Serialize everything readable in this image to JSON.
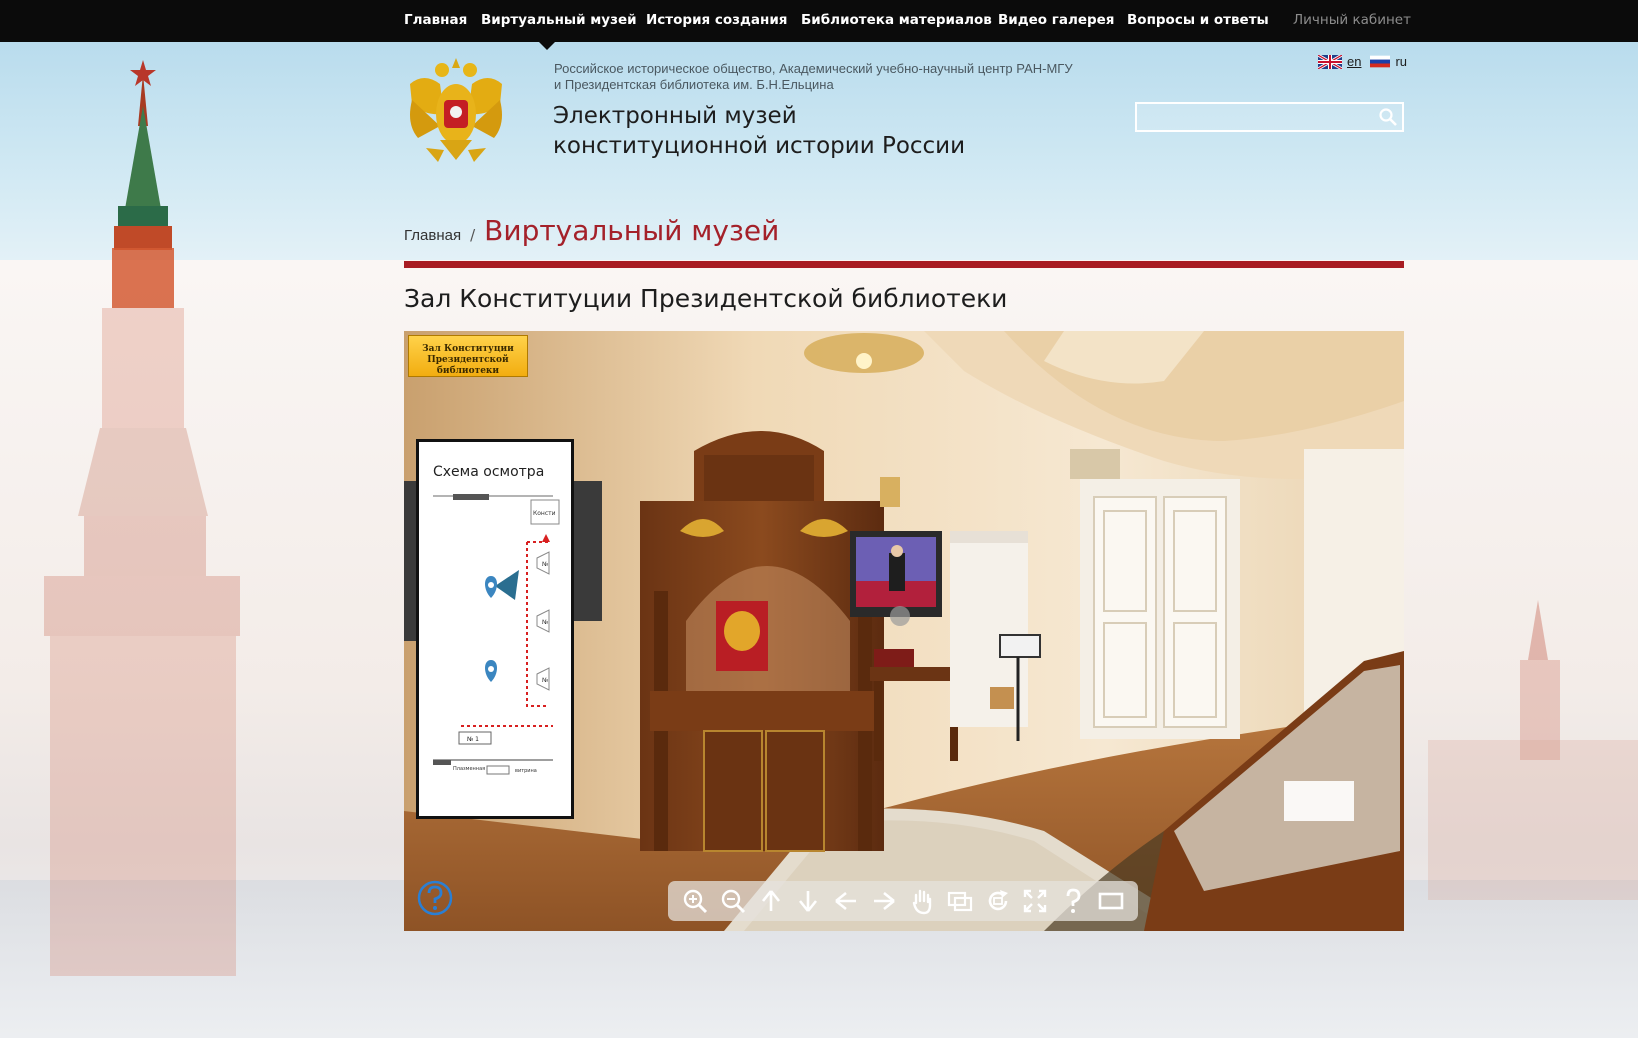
{
  "nav": {
    "items": [
      {
        "label": "Главная"
      },
      {
        "label": "Виртуальный музей"
      },
      {
        "label": "История создания"
      },
      {
        "label": "Библиотека материалов"
      },
      {
        "label": "Видео галерея"
      },
      {
        "label": "Вопросы и ответы"
      }
    ],
    "cabinet": "Личный кабинет"
  },
  "header": {
    "org_line1": "Российское историческое общество, Академический учебно-научный центр РАН-МГУ",
    "org_line2": "и Президентская библиотека им. Б.Н.Ельцина",
    "title_line1": "Электронный музей",
    "title_line2": "конституционной истории России",
    "lang_en": "en",
    "lang_ru": "ru",
    "search_placeholder": ""
  },
  "breadcrumb": {
    "home": "Главная",
    "separator": "/",
    "current": "Виртуальный музей"
  },
  "page": {
    "heading": "Зал Конституции Президентской библиотеки"
  },
  "pano": {
    "hall_label_line1": "Зал Конституции",
    "hall_label_line2": "Президентской библиотеки",
    "scheme_title": "Схема осмотра",
    "scheme_labels": {
      "konst": "Консти",
      "no": "№",
      "no1": "№ 1",
      "panel": "Плазменная панель",
      "vitrina": "витрина"
    },
    "toolbar": [
      "zoom-in-icon",
      "zoom-out-icon",
      "arrow-up-icon",
      "arrow-down-icon",
      "arrow-left-icon",
      "arrow-right-icon",
      "hand-icon",
      "hotspots-icon",
      "autorotate-icon",
      "fullscreen-icon",
      "help-icon",
      "window-icon"
    ]
  },
  "colors": {
    "nav_bg": "#0b0b0b",
    "accent_red": "#a81c22",
    "breadcrumb_current": "#a4212a",
    "sky": "#c4e3f0"
  }
}
